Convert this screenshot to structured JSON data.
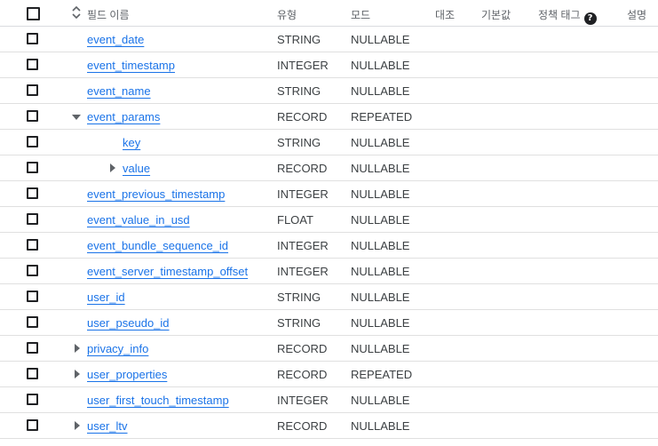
{
  "header": {
    "field_name": "필드 이름",
    "type": "유형",
    "mode": "모드",
    "collation": "대조",
    "default_value": "기본값",
    "policy_tag": "정책 태그",
    "description": "설명"
  },
  "rows": [
    {
      "name": "event_date",
      "type": "STRING",
      "mode": "NULLABLE"
    },
    {
      "name": "event_timestamp",
      "type": "INTEGER",
      "mode": "NULLABLE"
    },
    {
      "name": "event_name",
      "type": "STRING",
      "mode": "NULLABLE"
    },
    {
      "name": "event_params",
      "type": "RECORD",
      "mode": "REPEATED"
    },
    {
      "name": "key",
      "type": "STRING",
      "mode": "NULLABLE"
    },
    {
      "name": "value",
      "type": "RECORD",
      "mode": "NULLABLE"
    },
    {
      "name": "event_previous_timestamp",
      "type": "INTEGER",
      "mode": "NULLABLE"
    },
    {
      "name": "event_value_in_usd",
      "type": "FLOAT",
      "mode": "NULLABLE"
    },
    {
      "name": "event_bundle_sequence_id",
      "type": "INTEGER",
      "mode": "NULLABLE"
    },
    {
      "name": "event_server_timestamp_offset",
      "type": "INTEGER",
      "mode": "NULLABLE"
    },
    {
      "name": "user_id",
      "type": "STRING",
      "mode": "NULLABLE"
    },
    {
      "name": "user_pseudo_id",
      "type": "STRING",
      "mode": "NULLABLE"
    },
    {
      "name": "privacy_info",
      "type": "RECORD",
      "mode": "NULLABLE"
    },
    {
      "name": "user_properties",
      "type": "RECORD",
      "mode": "REPEATED"
    },
    {
      "name": "user_first_touch_timestamp",
      "type": "INTEGER",
      "mode": "NULLABLE"
    },
    {
      "name": "user_ltv",
      "type": "RECORD",
      "mode": "NULLABLE"
    }
  ]
}
